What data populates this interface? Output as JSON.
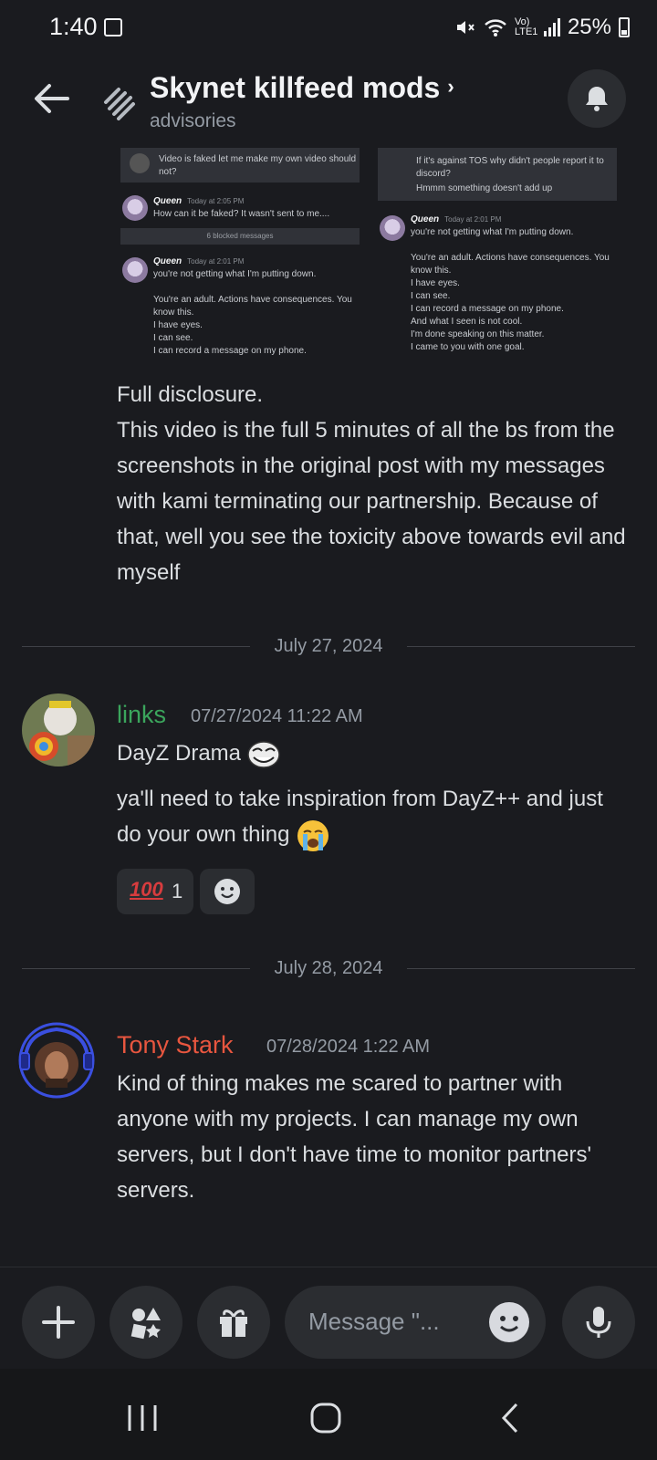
{
  "status_bar": {
    "time": "1:40",
    "network": "Vo) LTE1",
    "battery": "25%"
  },
  "header": {
    "title": "Skynet killfeed mods",
    "chevron": "›",
    "subtitle": "advisories"
  },
  "attachment": {
    "left": {
      "top_text": "Video is faked let me make my own video should not?",
      "msg1": {
        "name": "Queen",
        "time": "Today at 2:05 PM",
        "text": "How can it be faked? It wasn't sent to me...."
      },
      "blocked": "6 blocked messages",
      "msg2": {
        "name": "Queen",
        "time": "Today at 2:01 PM",
        "text": "you're not getting what I'm putting down."
      },
      "lines": [
        "You're an adult. Actions have consequences. You know this.",
        "I have eyes.",
        "I can see.",
        "I can record a message on my phone."
      ]
    },
    "right": {
      "box_lines": [
        "If it's against TOS why didn't people report it to discord?",
        "Hmmm something doesn't add up"
      ],
      "msg": {
        "name": "Queen",
        "time": "Today at 2:01 PM",
        "text": "you're not getting what I'm putting down."
      },
      "lines": [
        "You're an adult. Actions have consequences. You know this.",
        "I have eyes.",
        "I can see.",
        "I can record a message on my phone.",
        "And what I seen is not cool.",
        "I'm done speaking on this matter.",
        "I came to you with one goal."
      ]
    }
  },
  "disclosure": {
    "line1": "Full disclosure.",
    "line2": "This video is the full 5 minutes of all the bs from the screenshots in the original post with my messages with kami terminating our partnership. Because of that, well you see the toxicity above towards evil and myself"
  },
  "divider1": "July 27, 2024",
  "message_links": {
    "author": "links",
    "timestamp": "07/27/2024 11:22 AM",
    "line1": "DayZ Drama",
    "line2": "ya'll need to take inspiration from DayZ++ and just do your own thing",
    "reaction_emoji": "100",
    "reaction_count": "1"
  },
  "divider2": "July 28, 2024",
  "message_tony": {
    "author": "Tony Stark",
    "timestamp": "07/28/2024 1:22 AM",
    "text": "Kind of thing makes me scared to partner with anyone with my projects. I can manage my own servers, but I don't have time to monitor partners' servers."
  },
  "composer": {
    "placeholder": "Message \"..."
  },
  "colors": {
    "links_author": "#3ba55c",
    "tony_author": "#e8563f",
    "background": "#1a1b1f"
  }
}
